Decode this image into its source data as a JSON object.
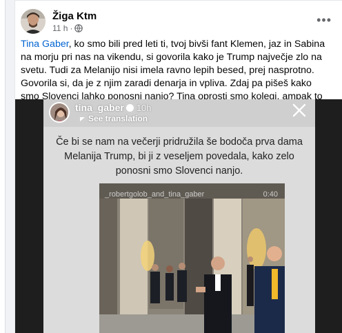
{
  "post": {
    "author": "Žiga Ktm",
    "time": "11 h",
    "time_separator": "·",
    "more_label": "•••",
    "mention": "Tina Gaber",
    "text": ", ko smo bili pred leti ti, tvoj bivši fant Klemen, jaz in Sabina na morju pri nas na vikendu, si govorila kako je Trump največje zlo na svetu. Tudi za Melanijo nisi imela ravno lepih besed, prej nasprotno. Govorila si, da je z njim zaradi denarja in vpliva. Zdaj pa pišeš kako smo Slovenci lahko ponosni nanjo? Tina oprosti smo kolegi, ampak to ni lepo in je zelo hinavsko.",
    "emoji": "😮"
  },
  "story": {
    "username": "tina_gaber",
    "time": "10h",
    "see_translation": "See translation",
    "text": "Če bi se nam na večerji pridružila še bodoča prva dama Melanija Trump, bi ji z veseljem povedala, kako zelo ponosni smo Slovenci nanjo.",
    "video_label": "_robertgolob_and_tina_gaber",
    "video_time": "0:40"
  },
  "colors": {
    "mention": "#0064d1",
    "text": "#050505",
    "meta": "#65676b"
  }
}
